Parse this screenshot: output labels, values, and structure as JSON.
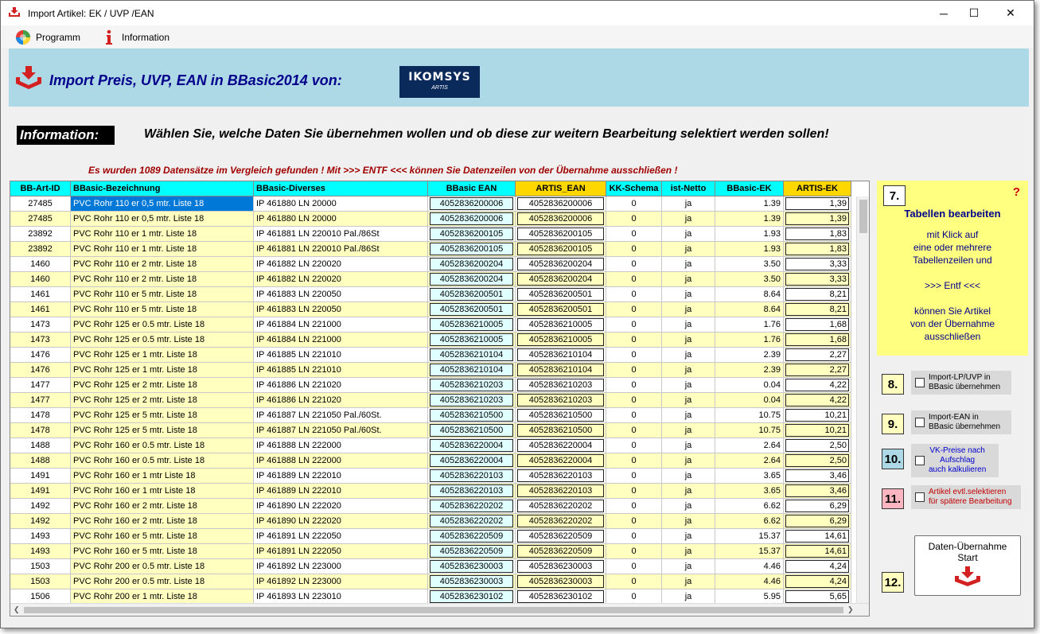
{
  "window": {
    "title": "Import Artikel:  EK / UVP /EAN",
    "controls": {
      "minimize": "─",
      "maximize": "☐",
      "close": "✕"
    }
  },
  "menu": {
    "items": [
      "Programm",
      "Information"
    ]
  },
  "banner": {
    "title": "Import Preis, UVP, EAN in BBasic2014  von:",
    "logo_main": "IKOMSYS",
    "logo_sub": "ARTIS"
  },
  "info": {
    "label": "Information:",
    "text": "Wählen Sie, welche Daten Sie übernehmen wollen und ob diese zur weitern Bearbeitung selektiert werden sollen!",
    "count_text": "Es wurden 1089 Datensätze im Vergleich gefunden !    Mit >>> ENTF <<< können Sie Datenzeilen von der Übernahme ausschließen !"
  },
  "table": {
    "columns": [
      "BB-Art-ID",
      "BBasic-Bezeichnung",
      "BBasic-Diverses",
      "BBasic EAN",
      "ARTIS_EAN",
      "KK-Schema",
      "ist-Netto",
      "BBasic-EK",
      "ARTIS-EK"
    ],
    "rows": [
      [
        "27485",
        "PVC  Rohr 110 er  0,5 mtr.  Liste 18",
        "IP 461880  LN 20000",
        "4052836200006",
        "4052836200006",
        "0",
        "ja",
        "1.39",
        "1,39"
      ],
      [
        "27485",
        "PVC  Rohr 110 er  0,5 mtr.  Liste 18",
        "IP 461880  LN 20000",
        "4052836200006",
        "4052836200006",
        "0",
        "ja",
        "1.39",
        "1,39"
      ],
      [
        "23892",
        "PVC Rohr  110 er  1 mtr.   Liste 18",
        "IP 461881  LN 220010  Pal./86St",
        "4052836200105",
        "4052836200105",
        "0",
        "ja",
        "1.93",
        "1,83"
      ],
      [
        "23892",
        "PVC Rohr  110 er  1 mtr.   Liste 18",
        "IP 461881  LN 220010  Pal./86St",
        "4052836200105",
        "4052836200105",
        "0",
        "ja",
        "1.93",
        "1,83"
      ],
      [
        "1460",
        "PVC Rohr  110 er  2 mtr.   Liste 18",
        "IP 461882  LN 220020",
        "4052836200204",
        "4052836200204",
        "0",
        "ja",
        "3.50",
        "3,33"
      ],
      [
        "1460",
        "PVC Rohr  110 er  2 mtr.   Liste 18",
        "IP 461882  LN 220020",
        "4052836200204",
        "4052836200204",
        "0",
        "ja",
        "3.50",
        "3,33"
      ],
      [
        "1461",
        "PVC Rohr  110 er  5 mtr.   Liste 18",
        "IP 461883  LN 220050",
        "4052836200501",
        "4052836200501",
        "0",
        "ja",
        "8.64",
        "8,21"
      ],
      [
        "1461",
        "PVC Rohr  110 er  5 mtr.   Liste 18",
        "IP 461883  LN 220050",
        "4052836200501",
        "4052836200501",
        "0",
        "ja",
        "8.64",
        "8,21"
      ],
      [
        "1473",
        "PVC Rohr  125 er  0.5 mtr.  Liste 18",
        "IP 461884  LN 221000",
        "4052836210005",
        "4052836210005",
        "0",
        "ja",
        "1.76",
        "1,68"
      ],
      [
        "1473",
        "PVC Rohr  125 er  0.5 mtr.  Liste 18",
        "IP 461884  LN 221000",
        "4052836210005",
        "4052836210005",
        "0",
        "ja",
        "1.76",
        "1,68"
      ],
      [
        "1476",
        "PVC Rohr  125 er  1 mtr.   Liste 18",
        "IP 461885  LN 221010",
        "4052836210104",
        "4052836210104",
        "0",
        "ja",
        "2.39",
        "2,27"
      ],
      [
        "1476",
        "PVC Rohr  125 er  1 mtr.   Liste 18",
        "IP 461885  LN 221010",
        "4052836210104",
        "4052836210104",
        "0",
        "ja",
        "2.39",
        "2,27"
      ],
      [
        "1477",
        "PVC Rohr  125 er  2 mtr.   Liste 18",
        "IP 461886  LN 221020",
        "4052836210203",
        "4052836210203",
        "0",
        "ja",
        "0.04",
        "4,22"
      ],
      [
        "1477",
        "PVC Rohr  125 er  2 mtr.   Liste 18",
        "IP 461886  LN 221020",
        "4052836210203",
        "4052836210203",
        "0",
        "ja",
        "0.04",
        "4,22"
      ],
      [
        "1478",
        "PVC Rohr  125 er  5 mtr.   Liste 18",
        "IP 461887  LN 221050  Pal./60St.",
        "4052836210500",
        "4052836210500",
        "0",
        "ja",
        "10.75",
        "10,21"
      ],
      [
        "1478",
        "PVC Rohr  125 er  5 mtr.   Liste 18",
        "IP 461887  LN 221050  Pal./60St.",
        "4052836210500",
        "4052836210500",
        "0",
        "ja",
        "10.75",
        "10,21"
      ],
      [
        "1488",
        "PVC Rohr  160 er  0.5 mtr.  Liste 18",
        "IP 461888  LN 222000",
        "4052836220004",
        "4052836220004",
        "0",
        "ja",
        "2.64",
        "2,50"
      ],
      [
        "1488",
        "PVC Rohr  160 er  0.5 mtr.  Liste 18",
        "IP 461888  LN 222000",
        "4052836220004",
        "4052836220004",
        "0",
        "ja",
        "2.64",
        "2,50"
      ],
      [
        "1491",
        "PVC Rohr  160 er  1 mtr    Liste 18",
        "IP 461889  LN 222010",
        "4052836220103",
        "4052836220103",
        "0",
        "ja",
        "3.65",
        "3,46"
      ],
      [
        "1491",
        "PVC Rohr  160 er  1 mtr    Liste 18",
        "IP 461889  LN 222010",
        "4052836220103",
        "4052836220103",
        "0",
        "ja",
        "3.65",
        "3,46"
      ],
      [
        "1492",
        "PVC Rohr  160 er  2 mtr.   Liste 18",
        "IP 461890  LN 222020",
        "4052836220202",
        "4052836220202",
        "0",
        "ja",
        "6.62",
        "6,29"
      ],
      [
        "1492",
        "PVC Rohr  160 er  2 mtr.   Liste 18",
        "IP 461890  LN 222020",
        "4052836220202",
        "4052836220202",
        "0",
        "ja",
        "6.62",
        "6,29"
      ],
      [
        "1493",
        "PVC Rohr  160 er  5 mtr.   Liste 18",
        "IP 461891  LN 222050",
        "4052836220509",
        "4052836220509",
        "0",
        "ja",
        "15.37",
        "14,61"
      ],
      [
        "1493",
        "PVC Rohr  160 er  5 mtr.   Liste 18",
        "IP 461891  LN 222050",
        "4052836220509",
        "4052836220509",
        "0",
        "ja",
        "15.37",
        "14,61"
      ],
      [
        "1503",
        "PVC Rohr  200 er  0.5 mtr.  Liste 18",
        "IP 461892  LN 223000",
        "4052836230003",
        "4052836230003",
        "0",
        "ja",
        "4.46",
        "4,24"
      ],
      [
        "1503",
        "PVC Rohr  200 er  0.5 mtr.  Liste 18",
        "IP 461892  LN 223000",
        "4052836230003",
        "4052836230003",
        "0",
        "ja",
        "4.46",
        "4,24"
      ],
      [
        "1506",
        "PVC Rohr  200 er  1 mtr.   Liste 18",
        "IP 461893  LN 223010",
        "4052836230102",
        "4052836230102",
        "0",
        "ja",
        "5.95",
        "5,65"
      ]
    ],
    "selected_cell": {
      "row": 0,
      "col": 1
    }
  },
  "panel7": {
    "number": "7.",
    "title": "Tabellen bearbeiten",
    "text": "mit  Klick auf\neine oder mehrere\nTabellenzeilen und\n\n>>>  Entf  <<<\n\nkönnen Sie Artikel\nvon der Übernahme\nausschließen",
    "help": "?"
  },
  "options": [
    {
      "number": "8.",
      "label": "Import-LP/UVP in\nBBasic übernehmen",
      "checked": false
    },
    {
      "number": "9.",
      "label": "Import-EAN in\nBBasic übernehmen",
      "checked": false
    },
    {
      "number": "10.",
      "label": "VK-Preise nach\nAufschlag\nauch kalkulieren",
      "checked": false
    },
    {
      "number": "11.",
      "label": "Artikel evtl.selektieren\nfür spätere Bearbeitung",
      "checked": false
    }
  ],
  "start": {
    "number": "12.",
    "label": "Daten-Übernahme\nStart"
  },
  "colors": {
    "header_cyan": "#00ffff",
    "header_orange": "#ffd700",
    "row_alt_yellow": "#ffffc0",
    "ean_cell": "#e0ffff",
    "selected": "#0078d7",
    "banner": "#add8e6",
    "panel_yellow": "#ffff80",
    "num10_bg": "#add8e6",
    "num11_bg": "#ffb6c1",
    "num8_bg": "#ffffc0"
  }
}
